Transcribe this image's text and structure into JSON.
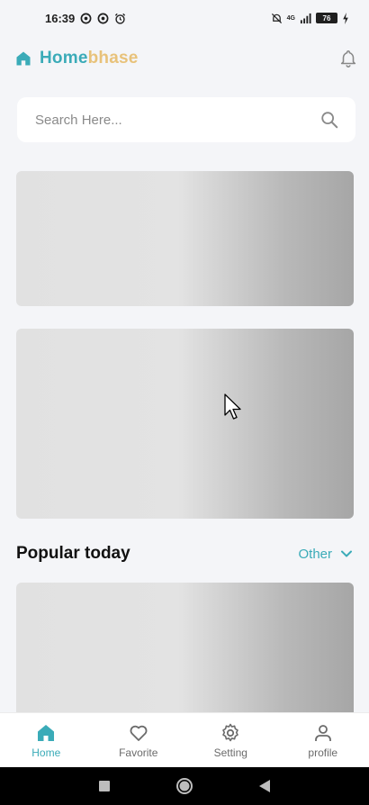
{
  "status": {
    "time": "16:39",
    "network": "4G",
    "battery": "76"
  },
  "header": {
    "brand_part1": "Home",
    "brand_part2": "bhase"
  },
  "search": {
    "placeholder": "Search Here..."
  },
  "section": {
    "title": "Popular today",
    "filter_label": "Other"
  },
  "bottom_nav": [
    {
      "label": "Home",
      "icon": "home-icon",
      "active": true
    },
    {
      "label": "Favorite",
      "icon": "heart-icon",
      "active": false
    },
    {
      "label": "Setting",
      "icon": "gear-icon",
      "active": false
    },
    {
      "label": "profile",
      "icon": "person-icon",
      "active": false
    }
  ],
  "colors": {
    "accent": "#3aabb8",
    "brand_secondary": "#e8c27a",
    "background": "#f4f5f8"
  }
}
